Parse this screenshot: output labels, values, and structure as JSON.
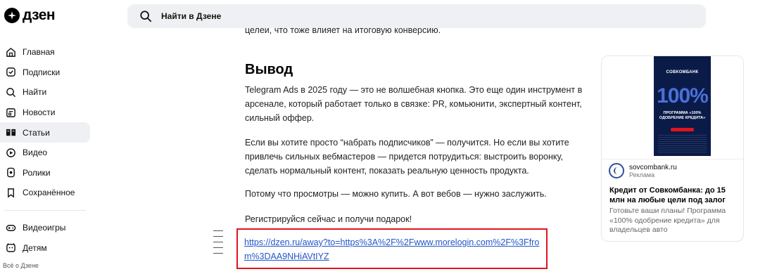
{
  "brand": {
    "logo_text": "дзен"
  },
  "search": {
    "placeholder": "Найти в Дзене"
  },
  "sidebar": {
    "items": [
      {
        "label": "Главная",
        "icon": "home-icon"
      },
      {
        "label": "Подписки",
        "icon": "subscriptions-icon"
      },
      {
        "label": "Найти",
        "icon": "search-icon"
      },
      {
        "label": "Новости",
        "icon": "news-icon"
      },
      {
        "label": "Статьи",
        "icon": "articles-icon",
        "active": true
      },
      {
        "label": "Видео",
        "icon": "video-icon"
      },
      {
        "label": "Ролики",
        "icon": "shorts-icon"
      },
      {
        "label": "Сохранённое",
        "icon": "bookmark-icon"
      }
    ],
    "items2": [
      {
        "label": "Видеоигры",
        "icon": "gamepad-icon"
      },
      {
        "label": "Детям",
        "icon": "kids-icon"
      }
    ],
    "footer_text": "Всё о Дзене"
  },
  "article": {
    "cut_text": "целей, что тоже влияет на итоговую конверсию.",
    "heading": "Вывод",
    "paragraphs": [
      "Telegram Ads в 2025 году — это не волшебная кнопка. Это еще один инструмент в арсенале, который работает только в связке: PR, комьюнити, экспертный контент, сильный оффер.",
      "Если вы хотите просто “набрать подписчиков” — получится. Но если вы хотите привлечь сильных вебмастеров — придется потрудиться: выстроить воронку, сделать нормальный контент, показать реальную ценность продукта.",
      "Потому что просмотры — можно купить. А вот вебов — нужно заслужить.",
      "Регистрируйся сейчас и получи подарок!"
    ],
    "link_text": "https://dzen.ru/away?to=https%3A%2F%2Fwww.morelogin.com%2F%3Ffrom%3DAA9NHiAVtIYZ"
  },
  "ad": {
    "image_brand": "СОВКОМБАНК",
    "image_number": "100%",
    "image_caption": "ПРОГРАММА «100% ОДОБРЕНИЕ КРЕДИТА»",
    "domain": "sovcombank.ru",
    "label": "Реклама",
    "title": "Кредит от Совкомбанка: до 15 млн на любые цели под залог",
    "description": "Готовьте ваши планы! Программа «100% одобрение кредита» для владельцев авто"
  },
  "colors": {
    "accent_link": "#2456c8",
    "highlight_border": "#e0141e",
    "active_nav_bg": "#eef0f3"
  }
}
